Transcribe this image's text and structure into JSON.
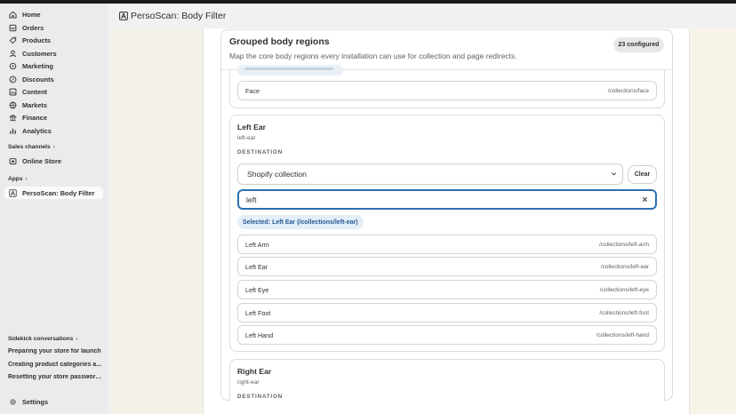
{
  "nav": {
    "items": [
      {
        "label": "Home",
        "icon": "home-icon"
      },
      {
        "label": "Orders",
        "icon": "orders-icon"
      },
      {
        "label": "Products",
        "icon": "products-icon"
      },
      {
        "label": "Customers",
        "icon": "customers-icon"
      },
      {
        "label": "Marketing",
        "icon": "marketing-icon"
      },
      {
        "label": "Discounts",
        "icon": "discounts-icon"
      },
      {
        "label": "Content",
        "icon": "content-icon"
      },
      {
        "label": "Markets",
        "icon": "markets-icon"
      },
      {
        "label": "Finance",
        "icon": "finance-icon"
      },
      {
        "label": "Analytics",
        "icon": "analytics-icon"
      }
    ],
    "sales_channels_label": "Sales channels",
    "online_store_label": "Online Store",
    "apps_label": "Apps",
    "app_item_label": "PersoScan: Body Filter",
    "sidekick_label": "Sidekick conversations",
    "sidekick_items": [
      "Preparing your store for launch",
      "Creating product categories a...",
      "Resetting your store password..."
    ],
    "settings_label": "Settings"
  },
  "app": {
    "title": "PersoScan: Body Filter"
  },
  "card": {
    "title": "Grouped body regions",
    "subtitle": "Map the core body regions every installation can use for collection and page redirects.",
    "badge": "23 configured"
  },
  "face": {
    "label": "Face",
    "path": "/collections/face"
  },
  "left_ear": {
    "name": "Left Ear",
    "slug": "left-ear",
    "destination_label": "DESTINATION",
    "select_value": "Shopify collection",
    "clear_label": "Clear",
    "search_value": "left",
    "selected_chip": "Selected: Left Ear (/collections/left-ear)",
    "results": [
      {
        "label": "Left Arm",
        "path": "/collections/left-arm"
      },
      {
        "label": "Left Ear",
        "path": "/collections/left-ear"
      },
      {
        "label": "Left Eye",
        "path": "/collections/left-eye"
      },
      {
        "label": "Left Foot",
        "path": "/collections/left-foot"
      },
      {
        "label": "Left Hand",
        "path": "/collections/left-hand"
      }
    ]
  },
  "right_ear": {
    "name": "Right Ear",
    "slug": "right-ear",
    "destination_label": "DESTINATION"
  },
  "colors": {
    "accent": "#2f6fb3",
    "chip_bg": "#e4eef8",
    "chip_text": "#245a94"
  }
}
